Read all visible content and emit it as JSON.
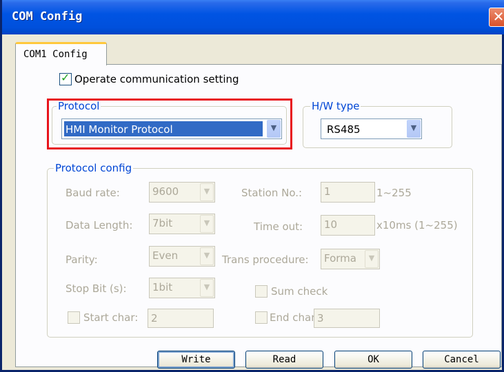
{
  "window": {
    "title": "COM Config"
  },
  "tabs": [
    {
      "label": "COM1 Config"
    }
  ],
  "operate_setting": {
    "label": "Operate communication setting",
    "checked": true
  },
  "protocol": {
    "legend": "Protocol",
    "selected": "HMI Monitor Protocol"
  },
  "hw_type": {
    "legend": "H/W type",
    "selected": "RS485"
  },
  "protocol_config": {
    "legend": "Protocol config",
    "baud_rate": {
      "label": "Baud rate:",
      "value": "9600"
    },
    "data_length": {
      "label": "Data Length:",
      "value": "7bit"
    },
    "parity": {
      "label": "Parity:",
      "value": "Even"
    },
    "stop_bit": {
      "label": "Stop Bit (s):",
      "value": "1bit"
    },
    "start_char": {
      "label": "Start char:",
      "value": "2"
    },
    "station_no": {
      "label": "Station No.:",
      "value": "1",
      "range": "1~255"
    },
    "time_out": {
      "label": "Time out:",
      "value": "10",
      "unit": "x10ms (1~255)"
    },
    "trans_procedure": {
      "label": "Trans procedure:",
      "value": "Forma"
    },
    "sum_check": {
      "label": "Sum check"
    },
    "end_char": {
      "label": "End char:",
      "value": "3"
    }
  },
  "buttons": {
    "write": "Write",
    "read": "Read",
    "ok": "OK",
    "cancel": "Cancel"
  },
  "icons": {
    "close": "close-icon",
    "dropdown": "chevron-down-icon",
    "check": "checkmark-icon"
  }
}
